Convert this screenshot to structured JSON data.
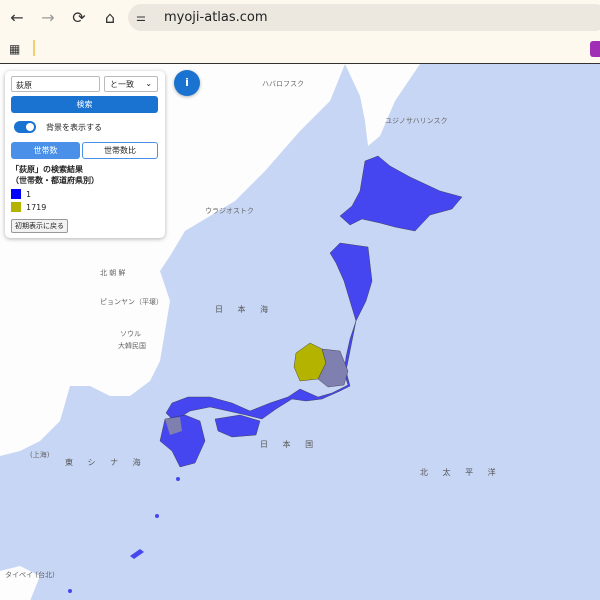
{
  "browser": {
    "url": "myoji-atlas.com",
    "back_icon": "←",
    "forward_icon": "→",
    "reload_icon": "⟳",
    "home_icon": "⌂",
    "apps_icon": "▦",
    "tune_icon": "⚌"
  },
  "panel": {
    "search_value": "荻原",
    "match_select": "と一致",
    "search_button": "検索",
    "toggle_label": "背景を表示する",
    "toggle_on": true,
    "tabs": [
      {
        "label": "世帯数",
        "active": true
      },
      {
        "label": "世帯数比",
        "active": false
      }
    ],
    "result_title": "「荻原」の検索結果",
    "result_subtitle": "（世帯数・都道府県別）",
    "legend": [
      {
        "label": "1",
        "color": "#0000ff"
      },
      {
        "label": "1719",
        "color": "#b3b300"
      }
    ],
    "reset_button": "初期表示に戻る"
  },
  "info_icon": "i",
  "map_labels": {
    "sea_japan": "日 本 海",
    "japan": "日 本 国",
    "east_china_sea": "東 シ ナ 海",
    "north_pacific": "北 太 平 洋",
    "vladivostok": "ウラジオストク",
    "north_korea": "北 朝 鮮",
    "pyongyang": "ピョンヤン（平壌）",
    "seoul": "ソウル",
    "south_korea": "大韓民国",
    "shanghai": "(上海)",
    "taipei": "タイペイ (台北)",
    "habarovsk": "ハバロフスク",
    "yuzhno": "ユジノサハリンスク"
  },
  "colors": {
    "sea": "#c7d6f5",
    "land": "#ffffff",
    "low": "#4646f0",
    "high": "#b3b300",
    "mid": "#7f7fb0"
  }
}
